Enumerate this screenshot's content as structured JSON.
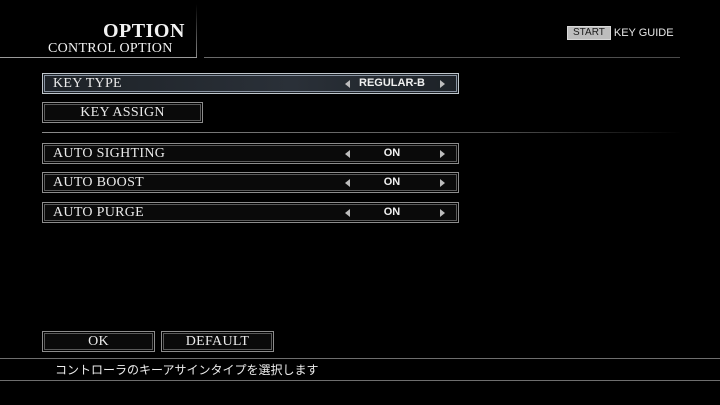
{
  "header": {
    "title": "OPTION",
    "subtitle": "CONTROL OPTION",
    "key_guide_badge": "START",
    "key_guide_label": "KEY GUIDE"
  },
  "options": {
    "key_type": {
      "label": "KEY TYPE",
      "value": "REGULAR-B"
    },
    "key_assign": {
      "label": "KEY ASSIGN"
    },
    "auto_sighting": {
      "label": "AUTO SIGHTING",
      "value": "ON"
    },
    "auto_boost": {
      "label": "AUTO BOOST",
      "value": "ON"
    },
    "auto_purge": {
      "label": "AUTO PURGE",
      "value": "ON"
    }
  },
  "footer": {
    "ok_label": "OK",
    "default_label": "DEFAULT",
    "help_text": "コントローラのキーアサインタイプを選択します"
  },
  "icons": {
    "decrease": "arrow-left-icon",
    "increase": "arrow-right-icon"
  },
  "colors": {
    "background": "#000000",
    "text": "#e8e8e8",
    "border": "#8c8c8c",
    "selected_border": "#bfc6cc"
  }
}
